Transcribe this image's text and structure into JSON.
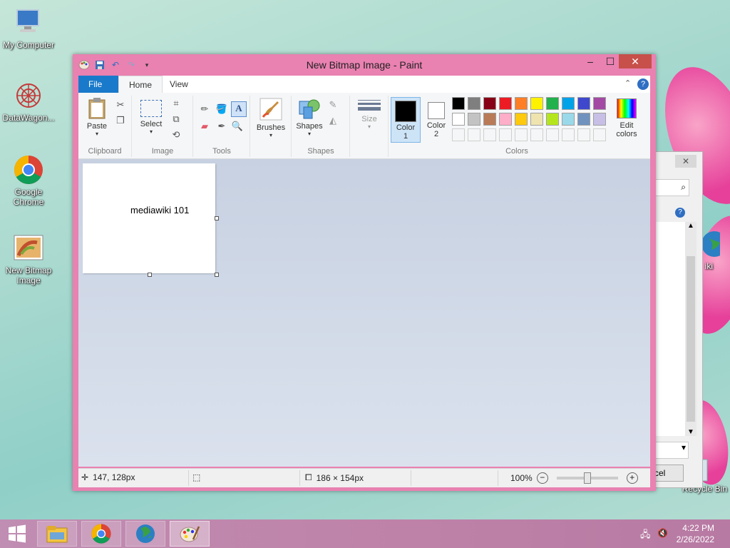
{
  "desktop": {
    "icons": [
      {
        "label": "My Computer"
      },
      {
        "label": "DataWagon..."
      },
      {
        "label": "Google Chrome"
      },
      {
        "label": "New Bitmap Image"
      },
      {
        "label": "Recycle Bin"
      }
    ],
    "partial_icon_label": "iki"
  },
  "background_window": {
    "partial_button": "cel"
  },
  "paint": {
    "title": "New Bitmap Image - Paint",
    "tabs": {
      "file": "File",
      "home": "Home",
      "view": "View"
    },
    "groups": {
      "clipboard": "Clipboard",
      "image": "Image",
      "tools": "Tools",
      "shapes": "Shapes",
      "colors": "Colors"
    },
    "buttons": {
      "paste": "Paste",
      "select": "Select",
      "brushes": "Brushes",
      "shapes": "Shapes",
      "size": "Size",
      "color1": "Color\n1",
      "color1_a": "Color",
      "color1_b": "1",
      "color2_a": "Color",
      "color2_b": "2",
      "edit_colors_a": "Edit",
      "edit_colors_b": "colors"
    },
    "palette_row1": [
      "#000000",
      "#7f7f7f",
      "#880015",
      "#ed1c24",
      "#ff7f27",
      "#fff200",
      "#22b14c",
      "#00a2e8",
      "#3f48cc",
      "#a349a4"
    ],
    "palette_row2": [
      "#ffffff",
      "#c3c3c3",
      "#b97a57",
      "#ffaec9",
      "#ffc90e",
      "#efe4b0",
      "#b5e61d",
      "#99d9ea",
      "#7092be",
      "#c8bfe7"
    ],
    "canvas_text": "mediawiki 101",
    "status": {
      "cursor_pos": "147, 128px",
      "image_size": "186 × 154px",
      "zoom": "100%"
    }
  },
  "taskbar": {
    "time": "4:22 PM",
    "date": "2/26/2022"
  },
  "colors": {
    "window_frame": "#e981b1",
    "file_tab": "#1979ca",
    "close_button": "#c7504a"
  }
}
